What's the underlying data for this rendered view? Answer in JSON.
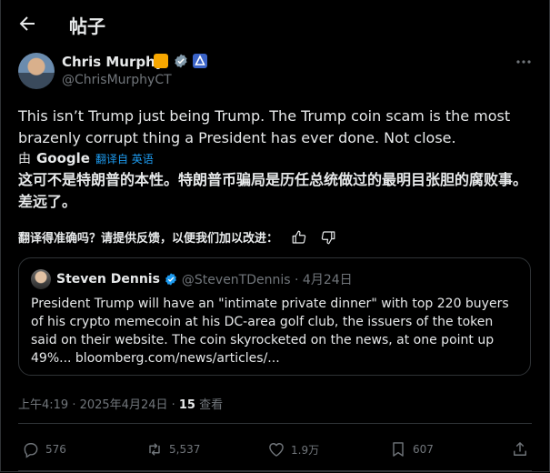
{
  "header": {
    "title": "帖子"
  },
  "author": {
    "name": "Chris Murphy",
    "handle": "@ChrisMurphyCT"
  },
  "post": {
    "text_en": "This isn’t Trump just being Trump. The Trump coin scam is the most brazenly corrupt thing a President has ever done. Not close.",
    "by_prefix": "由",
    "google": "Google",
    "translated_from": "翻译自 英语",
    "text_zh": "这可不是特朗普的本性。特朗普币骗局是历任总统做过的最明目张胆的腐败事。差远了。",
    "feedback_prompt": "翻译得准确吗？请提供反馈，以便我们加以改进："
  },
  "quote": {
    "name": "Steven Dennis",
    "meta": "@StevenTDennis · 4月24日",
    "text": "President Trump will have an \"intimate private dinner\" with top 220 buyers of his crypto memecoin at his DC-area golf club, the issuers of the token said on their website. The coin skyrocketed on the news, at one point up 49%... bloomberg.com/news/articles/..."
  },
  "meta": {
    "time": "上午4:19 · 2025年4月24日 · ",
    "views_count": "15",
    "views_label": " 查看"
  },
  "actions": {
    "replies": "576",
    "reposts": "5,537",
    "likes": "1.9万",
    "bookmarks": "607"
  },
  "colors": {
    "background": "#000000",
    "text": "#e7e9ea",
    "muted": "#71767b",
    "accent": "#1d9bf0",
    "border": "#2f3336"
  },
  "icons": [
    "back-arrow-icon",
    "orange-badge-icon",
    "verified-gray-icon",
    "blue-badge-icon",
    "more-icon",
    "thumbs-up-icon",
    "thumbs-down-icon",
    "verified-blue-icon",
    "reply-icon",
    "repost-icon",
    "like-icon",
    "bookmark-icon",
    "share-icon"
  ]
}
